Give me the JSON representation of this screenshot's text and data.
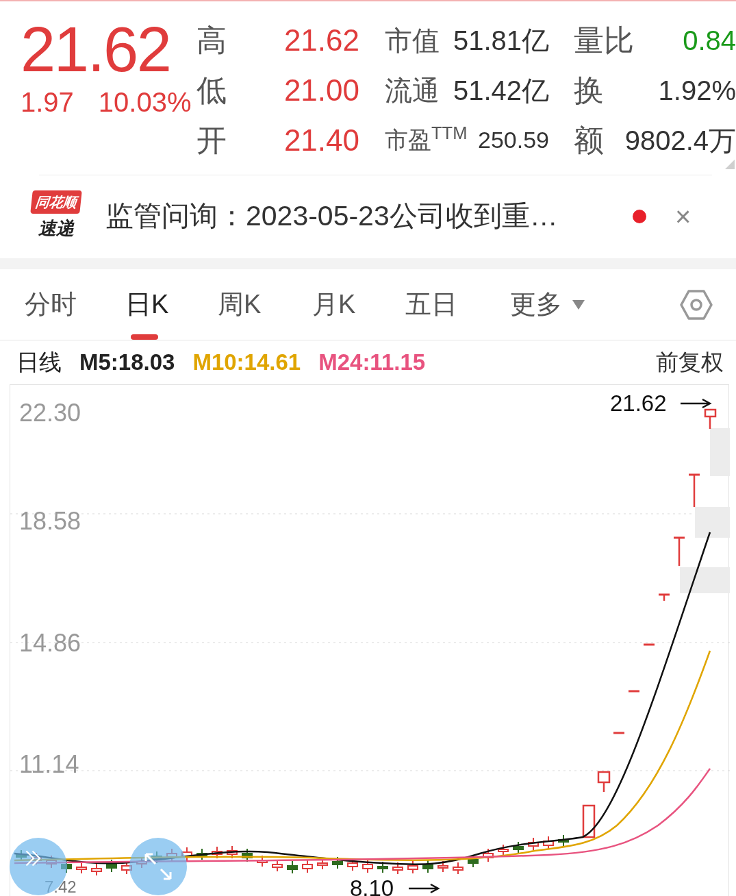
{
  "quote": {
    "price": "21.62",
    "change": "1.97",
    "change_pct": "10.03%",
    "columns": [
      [
        {
          "label": "高",
          "value": "21.62",
          "color": "#e03c3c"
        },
        {
          "label": "低",
          "value": "21.00",
          "color": "#e03c3c"
        },
        {
          "label": "开",
          "value": "21.40",
          "color": "#e03c3c"
        }
      ],
      [
        {
          "label": "市值",
          "value": "51.81亿",
          "color": "#333333"
        },
        {
          "label": "流通",
          "value": "51.42亿",
          "color": "#333333"
        },
        {
          "label": "市盈$^{TTM}$",
          "value": "250.59",
          "color": "#333333"
        }
      ],
      [
        {
          "label": "量比",
          "value": "0.84",
          "color": "#1a9a1a"
        },
        {
          "label": "换",
          "value": "1.92%",
          "color": "#333333"
        },
        {
          "label": "额",
          "value": "9802.4万",
          "color": "#333333"
        }
      ]
    ]
  },
  "news": {
    "logo_top": "同花顺",
    "logo_bottom": "速递",
    "text": "监管问询：2023-05-23公司收到重…",
    "unread": true,
    "close": "×"
  },
  "tabs": [
    {
      "label": "分时",
      "selected": false,
      "kind": "tab"
    },
    {
      "label": "日K",
      "selected": true,
      "kind": "tab"
    },
    {
      "label": "周K",
      "selected": false,
      "kind": "tab"
    },
    {
      "label": "月K",
      "selected": false,
      "kind": "tab"
    },
    {
      "label": "五日",
      "selected": false,
      "kind": "tab"
    },
    {
      "label": "更多",
      "selected": false,
      "kind": "dropdown"
    }
  ],
  "legend": {
    "title": "日线",
    "averages": [
      {
        "label": "M5:18.03",
        "color": "#222222"
      },
      {
        "label": "M10:14.61",
        "color": "#e0a500"
      },
      {
        "label": "M24:11.15",
        "color": "#e8537f"
      }
    ],
    "adjust": "前复权"
  },
  "chart": {
    "y_labels": [
      "22.30",
      "18.58",
      "14.86",
      "11.14"
    ],
    "last_price": "21.62",
    "low_price": "8.10",
    "left_price": "7.42"
  }
}
